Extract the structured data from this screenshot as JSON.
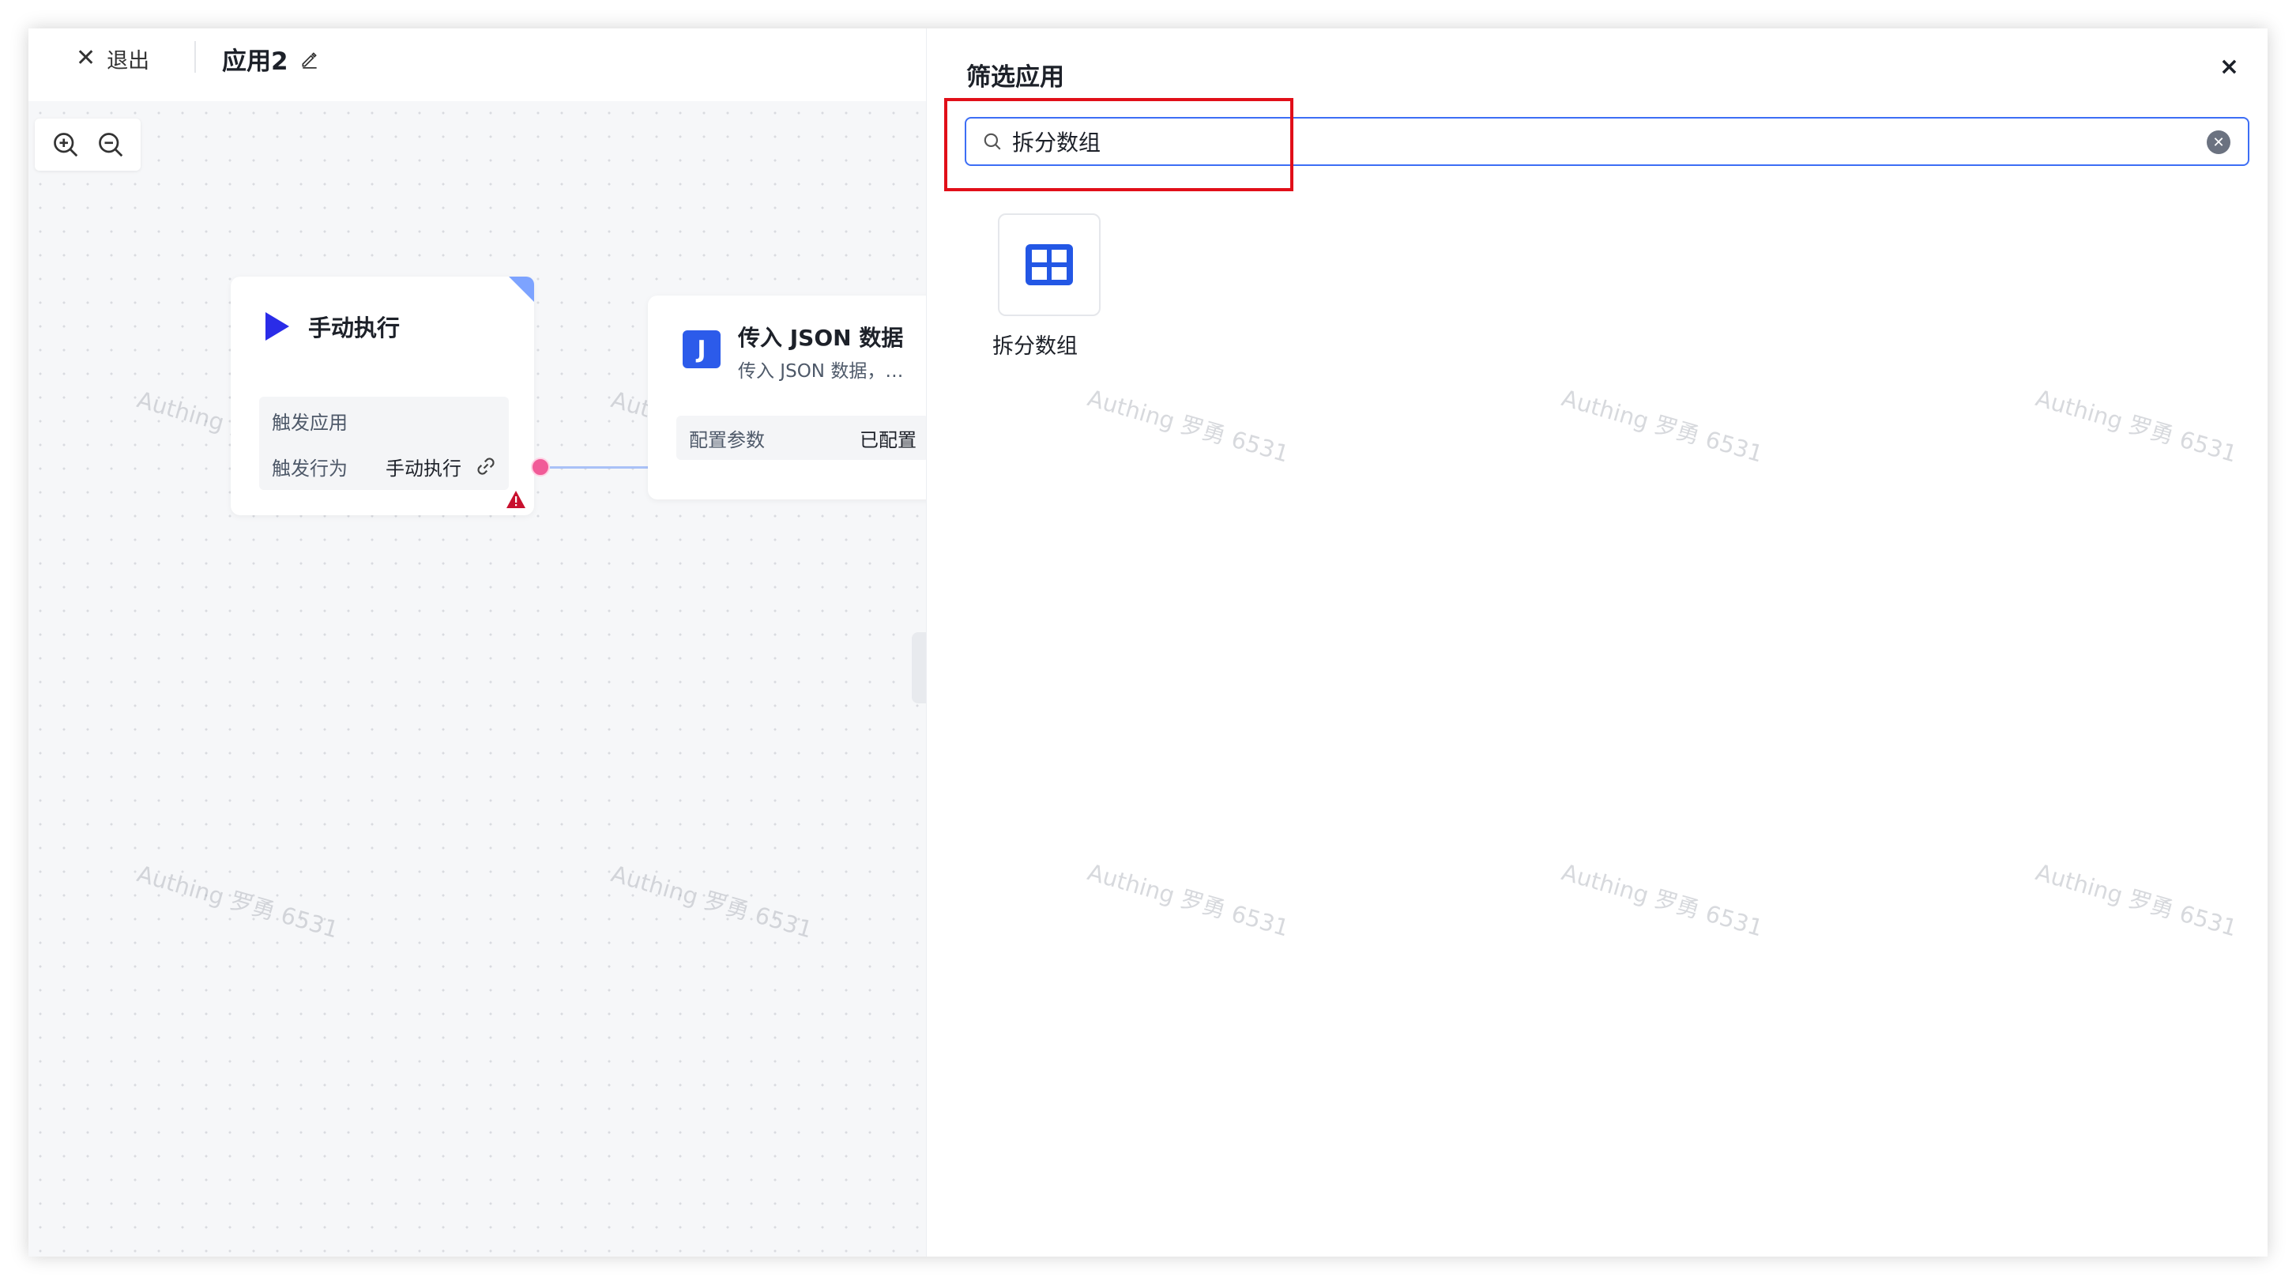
{
  "topbar": {
    "exit_label": "退出",
    "app_title": "应用2"
  },
  "canvas": {
    "watermark": "Authing 罗勇 6531",
    "nodes": {
      "manual": {
        "title": "手动执行",
        "props": [
          {
            "label": "触发应用",
            "value": ""
          },
          {
            "label": "触发行为",
            "value": "手动执行"
          }
        ]
      },
      "json": {
        "icon_letter": "J",
        "title": "传入 JSON 数据",
        "description": "传入 JSON 数据，…",
        "config_label": "配置参数",
        "config_value": "已配置"
      }
    }
  },
  "panel": {
    "title": "筛选应用",
    "close_label": "×",
    "search": {
      "value": "拆分数组"
    },
    "results": [
      {
        "label": "拆分数组",
        "icon": "grid-icon"
      }
    ]
  },
  "colors": {
    "accent": "#3d6ef5",
    "highlight": "#e10f19",
    "play": "#2a2ce8",
    "json_icon": "#2c5bea"
  }
}
